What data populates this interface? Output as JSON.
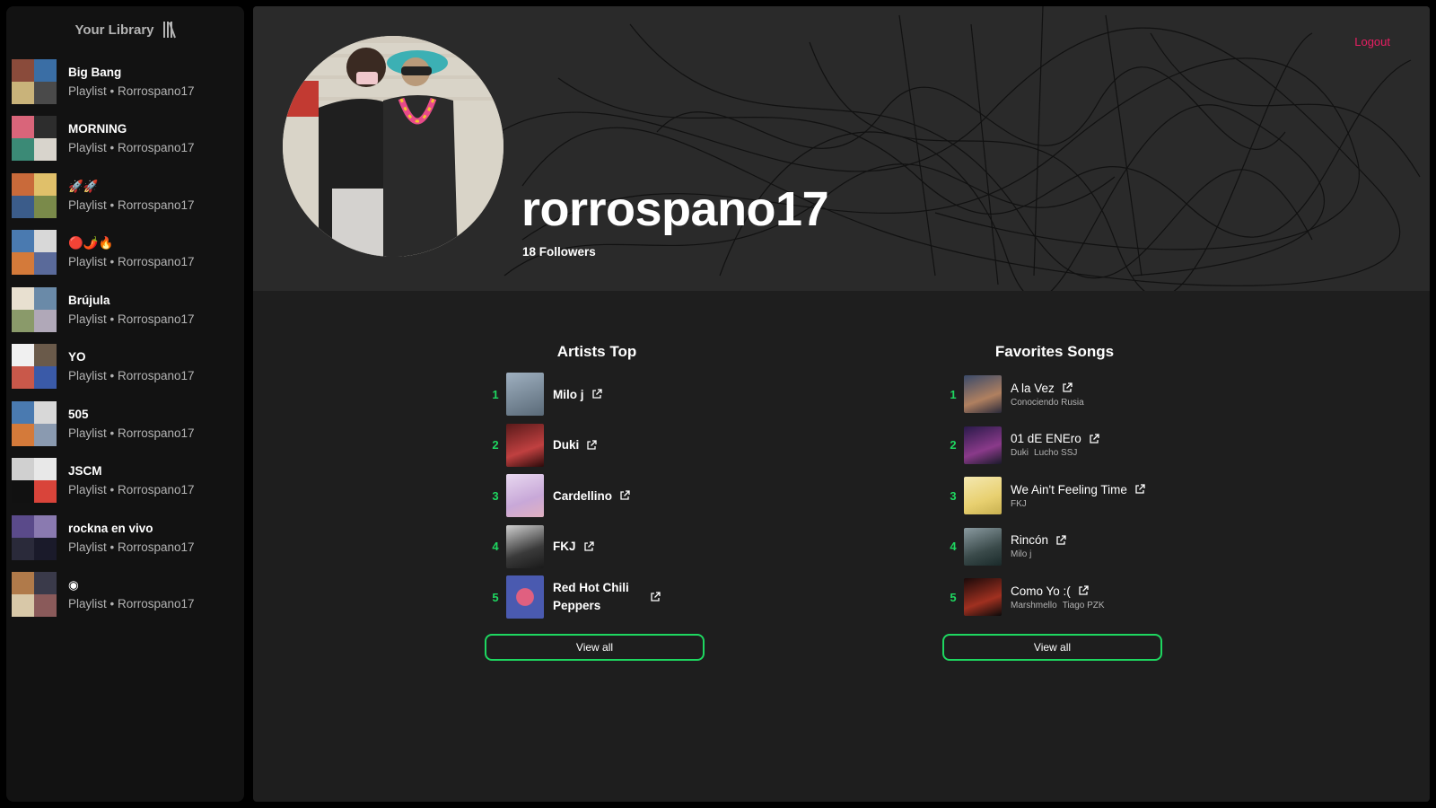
{
  "sidebar": {
    "title": "Your Library",
    "playlists": [
      {
        "name": "Big Bang",
        "subtitle": "Playlist • Rorrospano17"
      },
      {
        "name": "MORNING",
        "subtitle": "Playlist • Rorrospano17"
      },
      {
        "name": "🚀🚀",
        "subtitle": "Playlist • Rorrospano17"
      },
      {
        "name": "🔴🌶️🔥",
        "subtitle": "Playlist • Rorrospano17"
      },
      {
        "name": "Brújula",
        "subtitle": "Playlist • Rorrospano17"
      },
      {
        "name": "YO",
        "subtitle": "Playlist • Rorrospano17"
      },
      {
        "name": "505",
        "subtitle": "Playlist • Rorrospano17"
      },
      {
        "name": "JSCM",
        "subtitle": "Playlist • Rorrospano17"
      },
      {
        "name": "rockna en vivo",
        "subtitle": "Playlist • Rorrospano17"
      },
      {
        "name": "◉",
        "subtitle": "Playlist • Rorrospano17"
      }
    ]
  },
  "profile": {
    "username": "rorrospano17",
    "followers": "18 Followers",
    "logout_label": "Logout"
  },
  "artists_top": {
    "title": "Artists Top",
    "items": [
      {
        "rank": "1",
        "name": "Milo j"
      },
      {
        "rank": "2",
        "name": "Duki"
      },
      {
        "rank": "3",
        "name": "Cardellino"
      },
      {
        "rank": "4",
        "name": "FKJ"
      },
      {
        "rank": "5",
        "name": "Red Hot Chili Peppers"
      }
    ],
    "view_all_label": "View all"
  },
  "favorite_songs": {
    "title": "Favorites Songs",
    "items": [
      {
        "rank": "1",
        "name": "A la Vez",
        "artists": [
          "Conociendo Rusia"
        ]
      },
      {
        "rank": "2",
        "name": "01 dE ENEro",
        "artists": [
          "Duki",
          "Lucho SSJ"
        ]
      },
      {
        "rank": "3",
        "name": "We Ain't Feeling Time",
        "artists": [
          "FKJ"
        ]
      },
      {
        "rank": "4",
        "name": "Rincón",
        "artists": [
          "Milo j"
        ]
      },
      {
        "rank": "5",
        "name": "Como Yo :(",
        "artists": [
          "Marshmello",
          "Tiago PZK"
        ]
      }
    ],
    "view_all_label": "View all"
  },
  "colors": {
    "accent_green": "#1ed760",
    "logout_pink": "#e91e63",
    "sidebar_bg": "#121212",
    "main_bg": "#1e1e1e"
  },
  "icons": {
    "library": "library-icon",
    "external_link": "external-link-icon"
  }
}
